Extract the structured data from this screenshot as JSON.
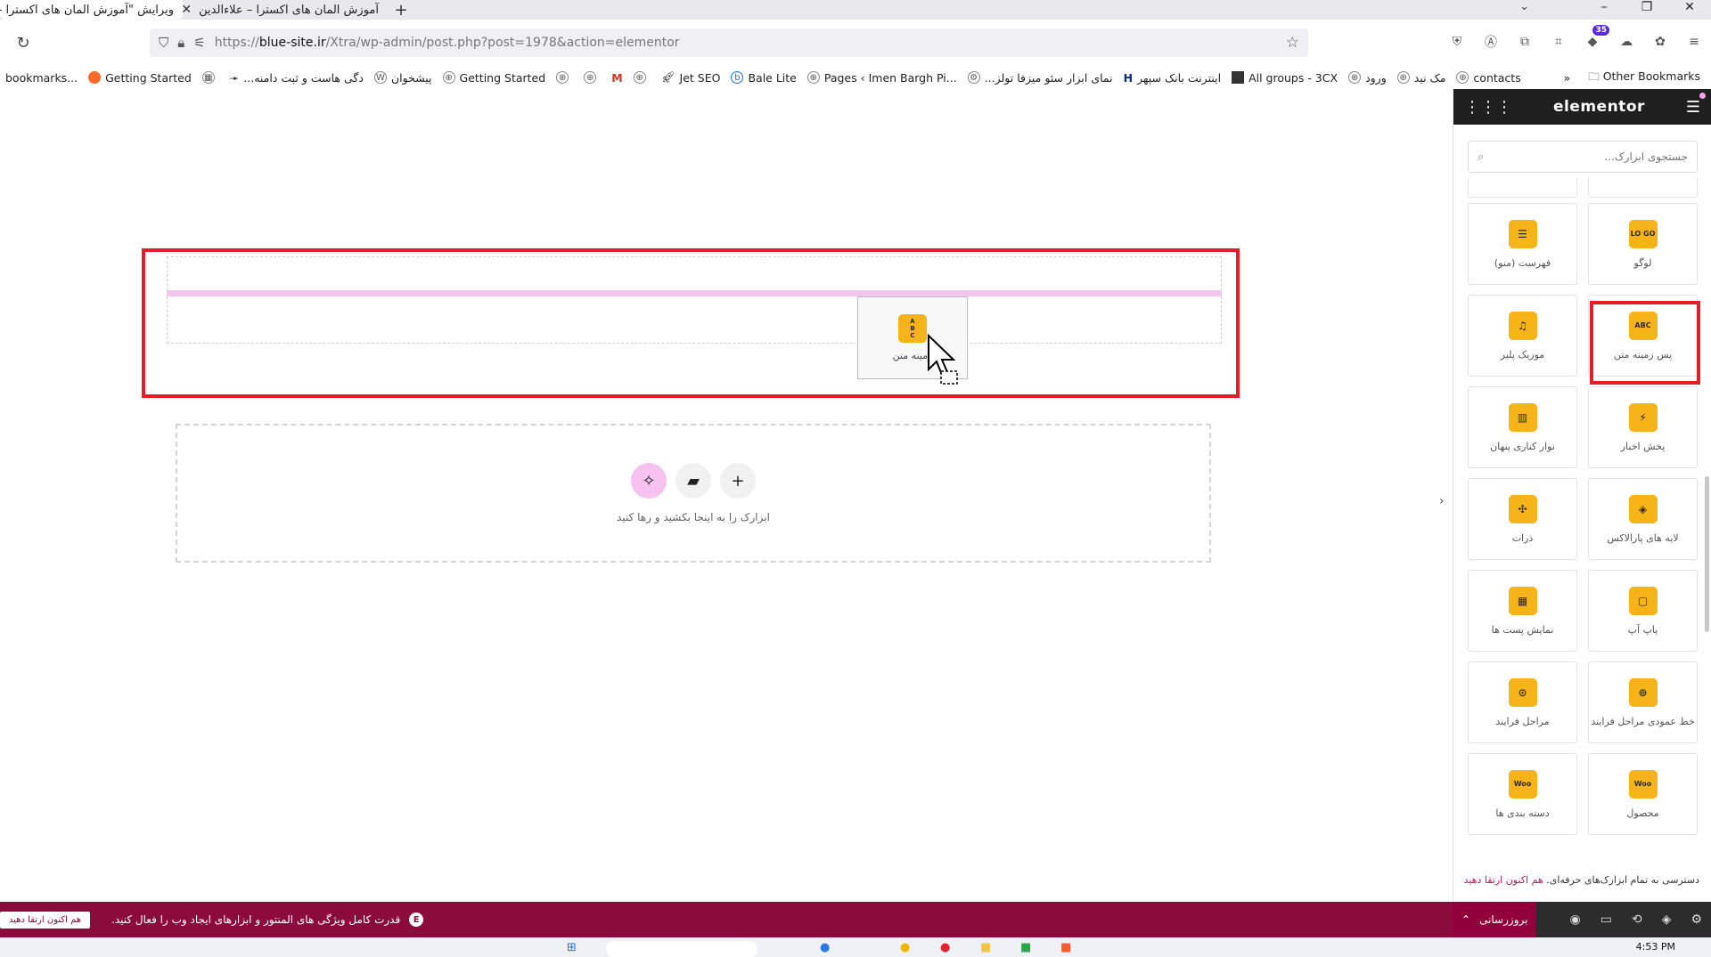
{
  "browser": {
    "tabs": [
      {
        "title": "ویرایش \"آموزش المان های اکسترا -",
        "active": true
      },
      {
        "title": "آموزش المان های اکسترا – علاءالدین",
        "active": false
      }
    ],
    "url": {
      "prefix": "https://",
      "host": "blue-site.ir",
      "path": "/Xtra/wp-admin/post.php?post=1978&action=elementor"
    },
    "ext_badge": "35",
    "bookmarks": [
      "bookmarks...",
      "Getting Started",
      "",
      "...دگی هاست و ثبت دامنه",
      "پیشخوان",
      "Getting Started",
      "",
      "",
      "M",
      "",
      "Jet SEO",
      "Bale Lite",
      "Pages ‹ Imen Bargh Pi...",
      "...نمای ابزار سئو میزفا تولز",
      "اینترنت بانک سپهر",
      "All groups - 3CX",
      "ورود",
      "مک نید",
      "contacts"
    ],
    "other_bookmarks": "Other Bookmarks"
  },
  "canvas": {
    "drag_ghost_label": "زمینه متن",
    "drop_hint": "ابزارک را به اینجا بکشید و رها کنید"
  },
  "panel": {
    "logo": "elementor",
    "search_placeholder": "جستجوی ابزارک...",
    "widgets": [
      {
        "label": "فهرست (منو)",
        "icon": "menu-cursor-icon",
        "glyph": "☰",
        "col": "left"
      },
      {
        "label": "لوگو",
        "icon": "logo-icon",
        "glyph": "LO GO",
        "col": "right"
      },
      {
        "label": "موزیک پلیر",
        "icon": "music-note-icon",
        "glyph": "♫",
        "col": "left"
      },
      {
        "label": "پس زمینه متن",
        "icon": "text-background-icon",
        "glyph": "ABC",
        "col": "right",
        "highlighted": true
      },
      {
        "label": "نوار کناری پنهان",
        "icon": "sidebar-icon",
        "glyph": "▥",
        "col": "left"
      },
      {
        "label": "پخش اخبار",
        "icon": "lightning-icon",
        "glyph": "⚡",
        "col": "right"
      },
      {
        "label": "ذرات",
        "icon": "particles-icon",
        "glyph": "✣",
        "col": "left"
      },
      {
        "label": "لایه های پارالاکس",
        "icon": "layers-icon",
        "glyph": "◈",
        "col": "right"
      },
      {
        "label": "نمایش پست ها",
        "icon": "posts-grid-icon",
        "glyph": "▦",
        "col": "left"
      },
      {
        "label": "پاپ آپ",
        "icon": "popup-icon",
        "glyph": "▢",
        "col": "right"
      },
      {
        "label": "مراحل فرایند",
        "icon": "process-steps-icon",
        "glyph": "⊙",
        "col": "left"
      },
      {
        "label": "خط عمودی مراحل فرایند",
        "icon": "vertical-process-icon",
        "glyph": "⊚",
        "col": "right"
      },
      {
        "label": "دسته بندی ها",
        "icon": "woo-icon",
        "glyph": "Woo",
        "col": "left"
      },
      {
        "label": "محصول",
        "icon": "woo-icon",
        "glyph": "Woo",
        "col": "right"
      }
    ],
    "pro_note": "دسترسی به تمام ابزارک‌های حرفه‌ای.",
    "pro_link": "هم اکنون ارتقا دهید",
    "update_button": "بروزرسانی"
  },
  "notice": {
    "text": "قدرت کامل ویژگی های المنتور و ابزارهای ایجاد وب را فعال کنید.",
    "button": "هم اکنون ارتقا دهید"
  },
  "taskbar": {
    "clock": "4:53 PM"
  }
}
